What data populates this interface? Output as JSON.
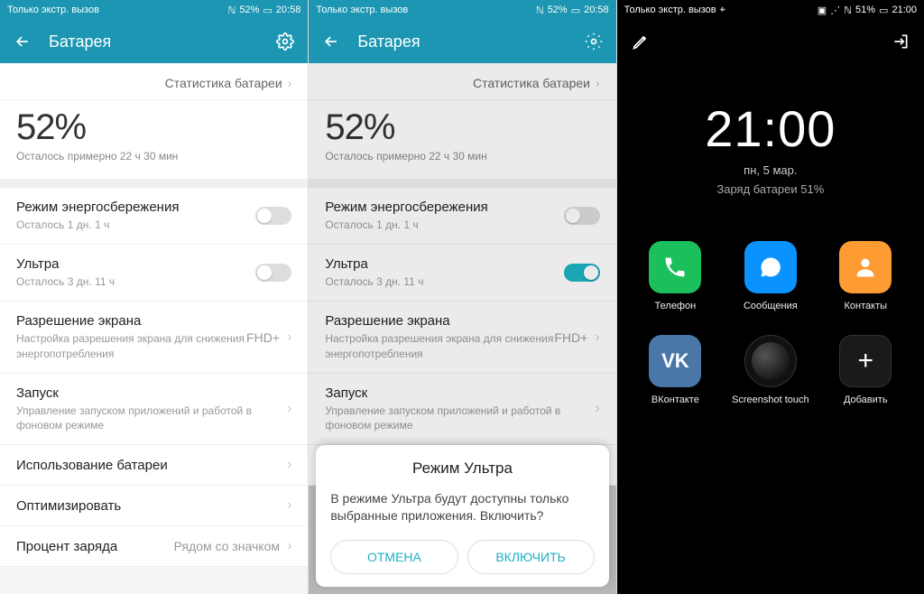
{
  "status": {
    "left_text": "Только экстр. вызов",
    "battery_pct_a": "52%",
    "time_a": "20:58",
    "battery_pct_c": "51%",
    "time_c": "21:00"
  },
  "header": {
    "title": "Батарея"
  },
  "battery": {
    "stats_link": "Статистика батареи",
    "percent": "52%",
    "remaining": "Осталось примерно 22 ч 30 мин"
  },
  "rows": {
    "power_saving": {
      "title": "Режим энергосбережения",
      "sub": "Осталось 1 дн. 1 ч"
    },
    "ultra": {
      "title": "Ультра",
      "sub": "Осталось 3 дн. 11 ч"
    },
    "resolution": {
      "title": "Разрешение экрана",
      "sub": "Настройка разрешения экрана для снижения энергопотребления",
      "value": "FHD+"
    },
    "launch": {
      "title": "Запуск",
      "sub": "Управление запуском приложений и работой в фоновом режиме"
    },
    "usage": {
      "title": "Использование батареи"
    },
    "optimize": {
      "title": "Оптимизировать"
    },
    "percent_row": {
      "title": "Процент заряда",
      "value": "Рядом со значком"
    }
  },
  "dialog": {
    "title": "Режим Ультра",
    "body": "В режиме Ультра будут доступны только выбранные приложения. Включить?",
    "cancel": "ОТМЕНА",
    "confirm": "ВКЛЮЧИТЬ"
  },
  "ultra_screen": {
    "time": "21:00",
    "date": "пн, 5 мар.",
    "battery": "Заряд батареи 51%",
    "apps": {
      "phone": "Телефон",
      "messages": "Сообщения",
      "contacts": "Контакты",
      "vk": "ВКонтакте",
      "screenshot": "Screenshot touch",
      "add": "Добавить"
    }
  }
}
